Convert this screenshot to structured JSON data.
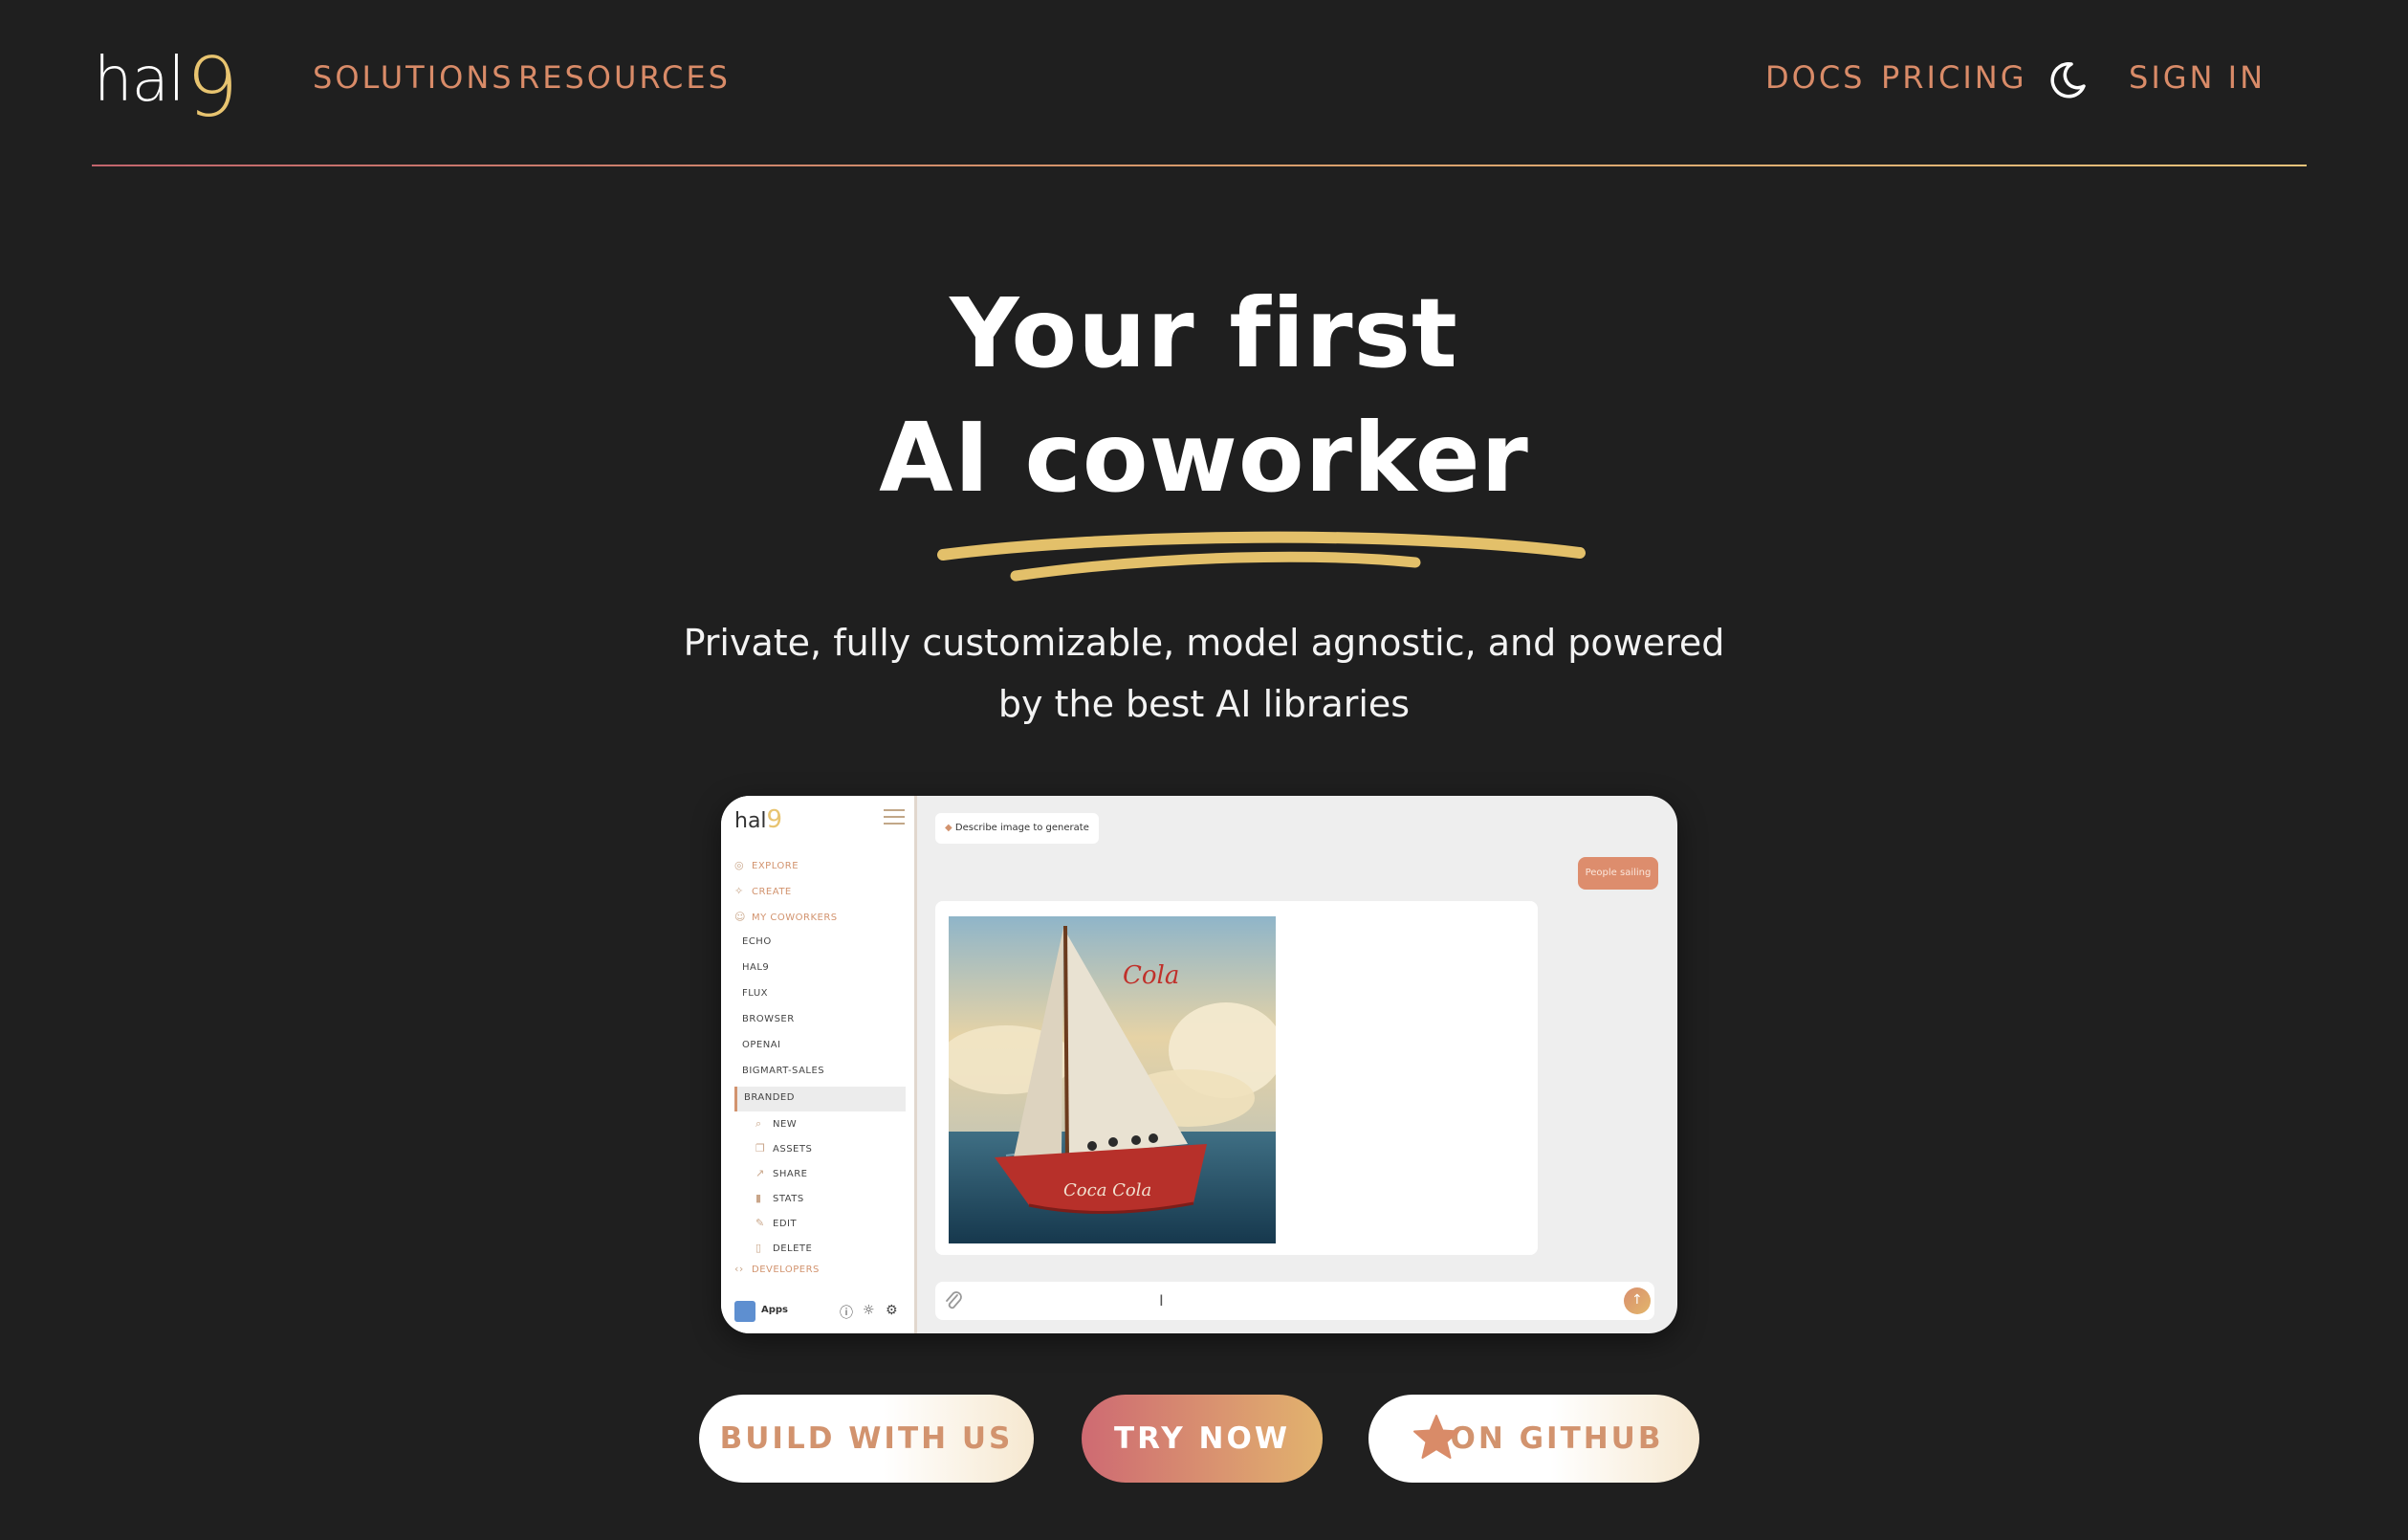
{
  "header": {
    "logo_text": "hal",
    "logo_mark": "9",
    "nav_left": [
      "SOLUTIONS",
      "RESOURCES"
    ],
    "nav_right": [
      "DOCS",
      "PRICING"
    ],
    "theme_icon": "moon-icon",
    "sign_in": "SIGN IN"
  },
  "hero": {
    "title_line1": "Your first",
    "title_line2": "AI coworker",
    "subtitle_line1": "Private, fully customizable, model agnostic, and powered",
    "subtitle_line2": "by the best AI libraries"
  },
  "preview": {
    "logo_text": "hal",
    "logo_mark": "9",
    "sidebar": {
      "explore": "EXPLORE",
      "create": "CREATE",
      "my_coworkers": "MY COWORKERS",
      "coworkers": [
        "ECHO",
        "HAL9",
        "FLUX",
        "BROWSER",
        "OPENAI",
        "BIGMART-SALES",
        "BRANDED"
      ],
      "actions": [
        "NEW",
        "ASSETS",
        "SHARE",
        "STATS",
        "EDIT",
        "DELETE"
      ],
      "developers": "DEVELOPERS",
      "footer_apps": "Apps"
    },
    "chat": {
      "chip_text": "Describe image to generate",
      "user_message": "People sailing"
    }
  },
  "cta": {
    "build": "BUILD WITH US",
    "try": "TRY NOW",
    "github": "ON GITHUB"
  },
  "colors": {
    "background": "#1f1f1f",
    "accent": "#d98b68",
    "gold": "#e8c470"
  }
}
